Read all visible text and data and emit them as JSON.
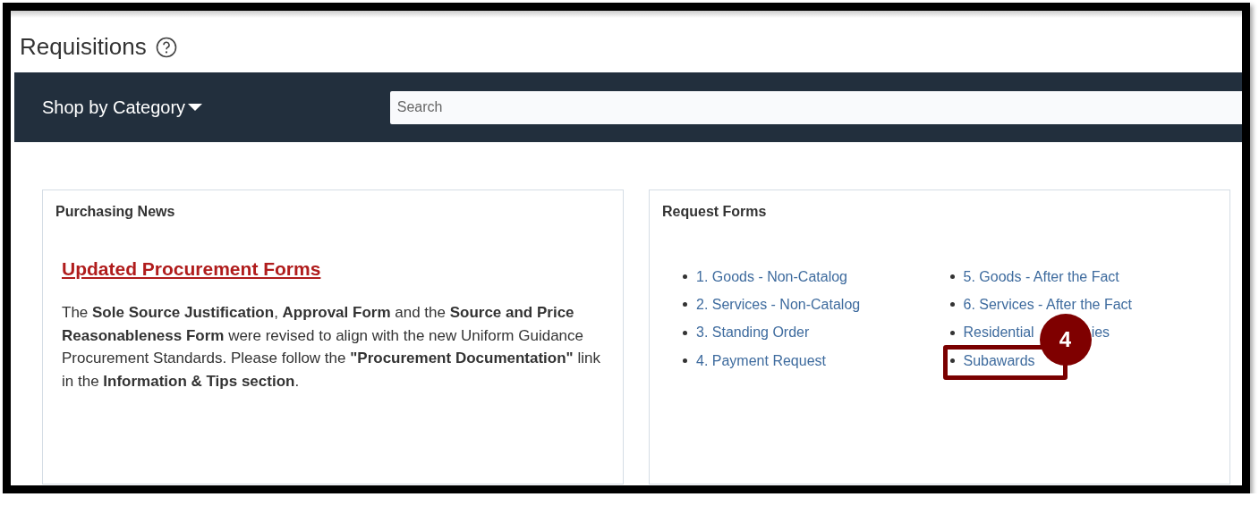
{
  "page": {
    "title": "Requisitions"
  },
  "navbar": {
    "category_menu": "Shop by Category",
    "search": {
      "placeholder": "Search"
    }
  },
  "purchasing_news": {
    "title": "Purchasing News",
    "headline": "Updated Procurement Forms",
    "body": "The **Sole Source Justification**, **Approval Form** and the **Source and Price Reasonableness Form** were revised to align with the new Uniform Guidance Procurement Standards. Please follow the **\"Procurement Documentation\"** link in the **Information & Tips section**."
  },
  "request_forms": {
    "title": "Request Forms",
    "columns": [
      [
        {
          "text": "1. Goods - Non-Catalog",
          "highlighted": false
        },
        {
          "text": "2. Services - Non-Catalog",
          "highlighted": false
        },
        {
          "text": "3. Standing Order",
          "highlighted": false
        },
        {
          "text": "4. Payment Request",
          "highlighted": false
        }
      ],
      [
        {
          "text": "5. Goods - After the Fact",
          "highlighted": false
        },
        {
          "text": "6. Services - After the Fact",
          "highlighted": false
        },
        {
          "text": "Residential",
          "tail": "ies",
          "highlighted": false
        },
        {
          "text": "Subawards",
          "highlighted": true,
          "callout": "4"
        }
      ]
    ]
  }
}
